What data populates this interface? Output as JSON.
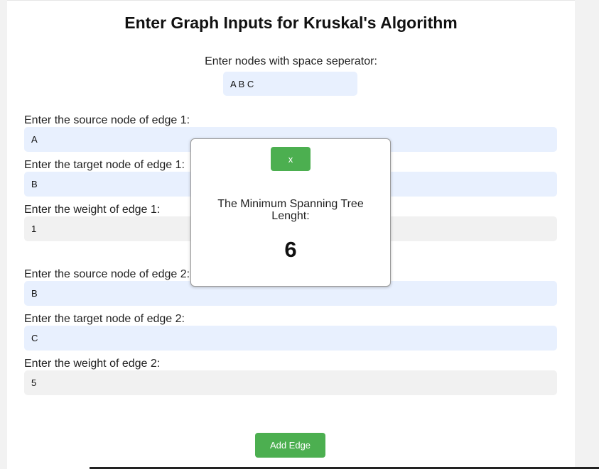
{
  "page": {
    "title": "Enter Graph Inputs for Kruskal's Algorithm",
    "nodes_label": "Enter nodes with space seperator:",
    "nodes_value": "A B C"
  },
  "edges": [
    {
      "source_label": "Enter the source node of edge 1:",
      "source_value": "A",
      "target_label": "Enter the target node of edge 1:",
      "target_value": "B",
      "weight_label": "Enter the weight of edge 1:",
      "weight_value": "1"
    },
    {
      "source_label": "Enter the source node of edge 2:",
      "source_value": "B",
      "target_label": "Enter the target node of edge 2:",
      "target_value": "C",
      "weight_label": "Enter the weight of edge 2:",
      "weight_value": "5"
    }
  ],
  "actions": {
    "add_edge_label": "Add Edge"
  },
  "modal": {
    "close_label": "x",
    "message": "The Minimum Spanning Tree Lenght:",
    "result": "6"
  },
  "colors": {
    "accent_green": "#4caf50",
    "autofill_blue": "#e8f0fe",
    "input_gray": "#f1f1f1"
  }
}
